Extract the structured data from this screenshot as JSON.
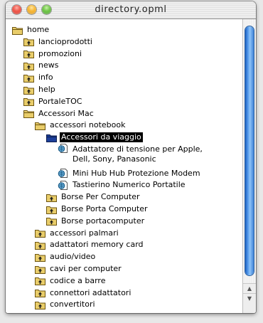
{
  "window": {
    "title": "directory.opml"
  },
  "tree": {
    "items": [
      {
        "label": "home",
        "icon": "folder-open-icon",
        "level": 0
      },
      {
        "label": "lancioprodotti",
        "icon": "folder-arrow-icon",
        "level": 1
      },
      {
        "label": "promozioni",
        "icon": "folder-arrow-icon",
        "level": 1
      },
      {
        "label": "news",
        "icon": "folder-arrow-icon",
        "level": 1
      },
      {
        "label": "info",
        "icon": "folder-arrow-icon",
        "level": 1
      },
      {
        "label": "help",
        "icon": "folder-arrow-icon",
        "level": 1
      },
      {
        "label": "PortaleTOC",
        "icon": "folder-arrow-icon",
        "level": 1
      },
      {
        "label": "Accessori Mac",
        "icon": "folder-open-icon",
        "level": 1
      },
      {
        "label": "accessori notebook",
        "icon": "folder-open-icon",
        "level": 2
      },
      {
        "label": "Accessori da viaggio",
        "icon": "folder-selected-icon",
        "level": 3,
        "selected": true
      },
      {
        "label": "Adattatore di tensione per Apple, Dell, Sony, Panasonic",
        "icon": "globe-document-icon",
        "level": 4,
        "multiline": true
      },
      {
        "label": "Mini Hub Hub Protezione Modem",
        "icon": "globe-document-icon",
        "level": 4
      },
      {
        "label": "Tastierino Numerico Portatile",
        "icon": "globe-document-icon",
        "level": 4
      },
      {
        "label": "Borse Per Computer",
        "icon": "folder-arrow-icon",
        "level": 3
      },
      {
        "label": "Borse Porta Computer",
        "icon": "folder-arrow-icon",
        "level": 3
      },
      {
        "label": "Borse portacomputer",
        "icon": "folder-arrow-icon",
        "level": 3
      },
      {
        "label": "accessori palmari",
        "icon": "folder-arrow-icon",
        "level": 2
      },
      {
        "label": "adattatori memory card",
        "icon": "folder-arrow-icon",
        "level": 2
      },
      {
        "label": "audio/video",
        "icon": "folder-arrow-icon",
        "level": 2
      },
      {
        "label": "cavi per computer",
        "icon": "folder-arrow-icon",
        "level": 2
      },
      {
        "label": "codice a barre",
        "icon": "folder-arrow-icon",
        "level": 2
      },
      {
        "label": "connettori adattatori",
        "icon": "folder-arrow-icon",
        "level": 2
      },
      {
        "label": "convertitori",
        "icon": "folder-arrow-icon",
        "level": 2
      }
    ]
  },
  "colors": {
    "folder": "#e9cd6a",
    "selection": "#000000",
    "scroll_thumb": "#3d82d8"
  }
}
